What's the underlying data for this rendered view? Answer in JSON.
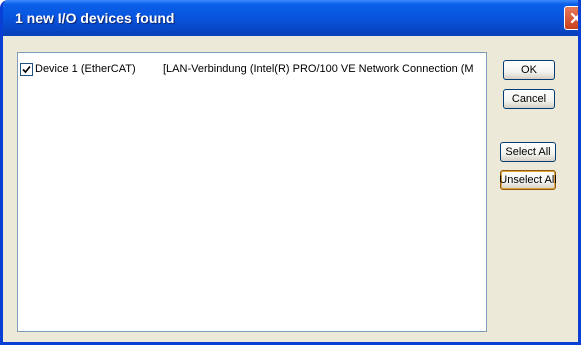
{
  "dialog": {
    "title": "1 new I/O devices found"
  },
  "device_list": {
    "items": [
      {
        "checked": true,
        "name": "Device 1 (EtherCAT)",
        "adapter": "[LAN-Verbindung (Intel(R) PRO/100 VE Network Connection (M"
      }
    ]
  },
  "buttons": {
    "ok": "OK",
    "cancel": "Cancel",
    "select_all": "Select All",
    "unselect_all": "Unselect All"
  },
  "icons": {
    "close": "close-icon",
    "checkbox": "checkmark-icon"
  },
  "colors": {
    "titlebar": "#0856e0",
    "dialog_bg": "#ece9d8",
    "close_button": "#c9401c",
    "button_border": "#003c74",
    "focus_ring": "#e5a33b"
  }
}
